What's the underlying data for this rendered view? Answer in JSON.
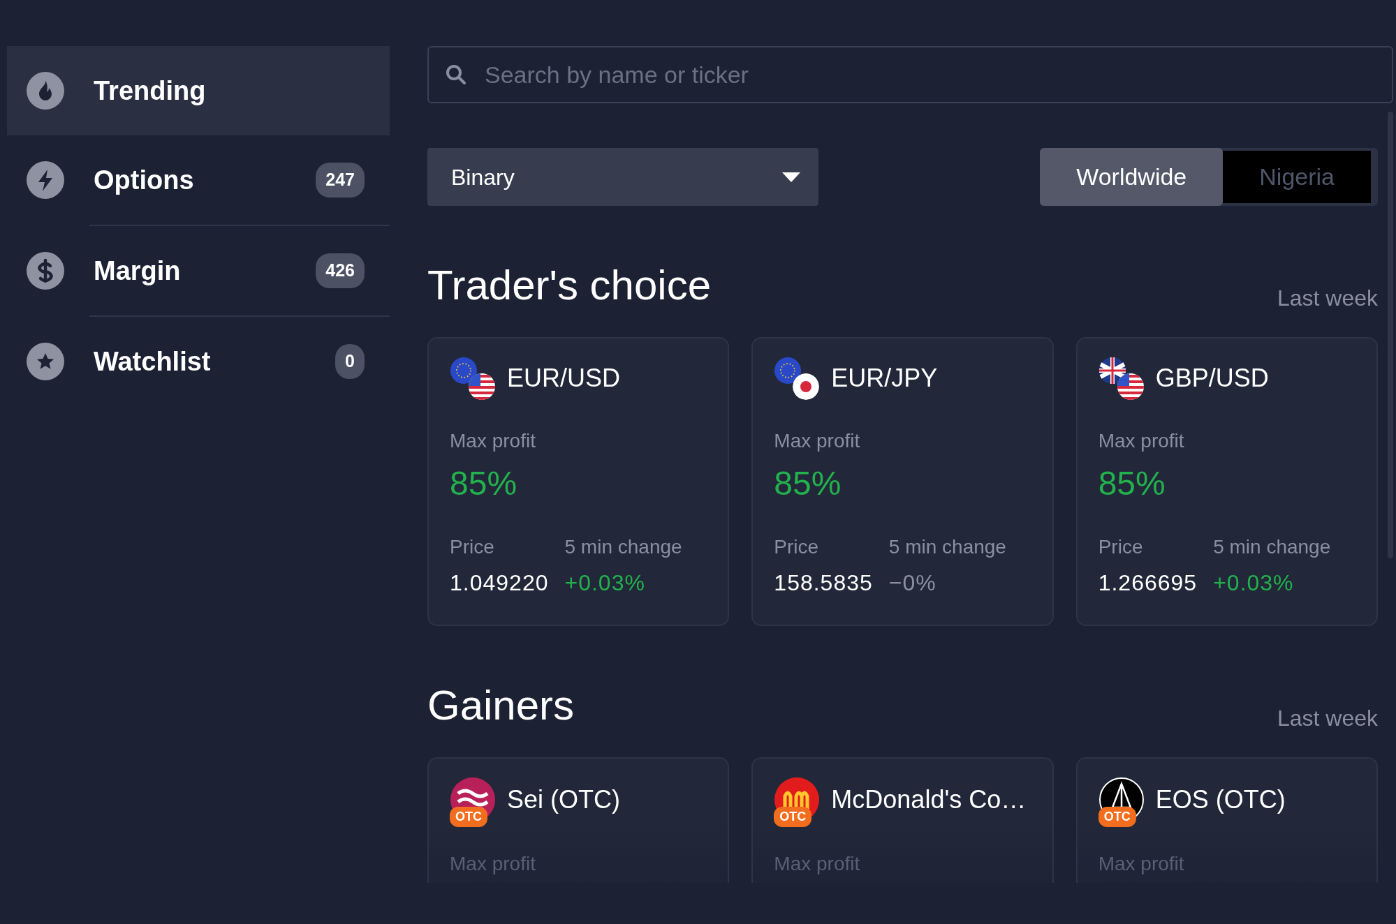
{
  "sidebar": {
    "items": [
      {
        "label": "Trending",
        "selected": true
      },
      {
        "label": "Options",
        "count": "247",
        "selected": false
      },
      {
        "label": "Margin",
        "count": "426",
        "selected": false
      },
      {
        "label": "Watchlist",
        "count": "0",
        "selected": false
      }
    ]
  },
  "search": {
    "placeholder": "Search by name or ticker"
  },
  "instrument_type": {
    "value": "Binary"
  },
  "region_tabs": [
    {
      "label": "Worldwide",
      "selected": true
    },
    {
      "label": "Nigeria",
      "selected": false
    }
  ],
  "sections": [
    {
      "title": "Trader's choice",
      "period": "Last week",
      "cards": [
        {
          "name": "EUR/USD",
          "profit_label": "Max profit",
          "profit": "85%",
          "price_label": "Price",
          "price": "1.049220",
          "change_label": "5 min change",
          "change": "+0.03%",
          "rising": true
        },
        {
          "name": "EUR/JPY",
          "profit_label": "Max profit",
          "profit": "85%",
          "price_label": "Price",
          "price": "158.5835",
          "change_label": "5 min change",
          "change": "−0%",
          "rising": false
        },
        {
          "name": "GBP/USD",
          "profit_label": "Max profit",
          "profit": "85%",
          "price_label": "Price",
          "price": "1.266695",
          "change_label": "5 min change",
          "change": "+0.03%",
          "rising": true
        }
      ]
    },
    {
      "title": "Gainers",
      "period": "Last week",
      "cards": [
        {
          "name": "Sei (OTC)",
          "badge": "OTC",
          "profit_label": "Max profit"
        },
        {
          "name": "McDonald's Co…",
          "badge": "OTC",
          "profit_label": "Max profit"
        },
        {
          "name": "EOS (OTC)",
          "badge": "OTC",
          "profit_label": "Max profit"
        }
      ]
    }
  ]
}
